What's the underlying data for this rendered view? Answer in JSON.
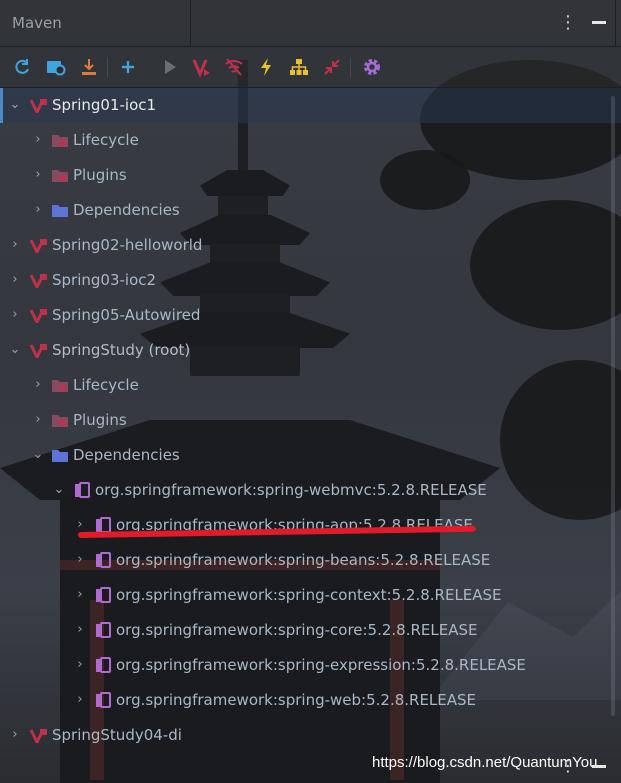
{
  "window": {
    "title": "Maven",
    "kebab_glyph": "⋮"
  },
  "toolbar": {
    "buttons": [
      {
        "name": "reload-icon",
        "color": "#3da5e0"
      },
      {
        "name": "generate-sources-icon",
        "color": "#3da5e0"
      },
      {
        "name": "download-icon",
        "color": "#e07b3d"
      },
      {
        "name": "add-icon",
        "color": "#3da5e0"
      },
      {
        "name": "run-icon",
        "color": "#6b6f75"
      },
      {
        "name": "execute-goal-icon",
        "color": "#c0304a"
      },
      {
        "name": "toggle-offline-icon",
        "color": "#c0304a"
      },
      {
        "name": "skip-tests-icon",
        "color": "#e8c12e"
      },
      {
        "name": "show-dependencies-icon",
        "color": "#e8c12e"
      },
      {
        "name": "collapse-all-icon",
        "color": "#c0304a"
      },
      {
        "name": "settings-icon",
        "color": "#a66bd4"
      }
    ]
  },
  "tree": {
    "rows": [
      {
        "label": "Spring01-ioc1",
        "expanded": true,
        "icon": "maven-project-icon",
        "level": 0
      },
      {
        "label": "Lifecycle",
        "expanded": false,
        "icon": "folder-gear-icon",
        "level": 1
      },
      {
        "label": "Plugins",
        "expanded": false,
        "icon": "folder-gear-icon",
        "level": 1
      },
      {
        "label": "Dependencies",
        "expanded": false,
        "icon": "folder-blue-icon",
        "level": 1
      },
      {
        "label": "Spring02-helloworld",
        "expanded": false,
        "icon": "maven-project-icon",
        "level": 0
      },
      {
        "label": "Spring03-ioc2",
        "expanded": false,
        "icon": "maven-project-icon",
        "level": 0
      },
      {
        "label": "Spring05-Autowired",
        "expanded": false,
        "icon": "maven-project-icon",
        "level": 0
      },
      {
        "label": "SpringStudy (root)",
        "expanded": true,
        "icon": "maven-project-icon",
        "level": 0
      },
      {
        "label": "Lifecycle",
        "expanded": false,
        "icon": "folder-gear-icon",
        "level": 1
      },
      {
        "label": "Plugins",
        "expanded": false,
        "icon": "folder-gear-icon",
        "level": 1
      },
      {
        "label": "Dependencies",
        "expanded": true,
        "icon": "folder-blue-icon",
        "level": 1
      },
      {
        "label": "org.springframework:spring-webmvc:5.2.8.RELEASE",
        "expanded": true,
        "icon": "library-icon",
        "level": 2
      },
      {
        "label": "org.springframework:spring-aop:5.2.8.RELEASE",
        "expanded": false,
        "icon": "library-icon",
        "level": 3
      },
      {
        "label": "org.springframework:spring-beans:5.2.8.RELEASE",
        "expanded": false,
        "icon": "library-icon",
        "level": 3
      },
      {
        "label": "org.springframework:spring-context:5.2.8.RELEASE",
        "expanded": false,
        "icon": "library-icon",
        "level": 3
      },
      {
        "label": "org.springframework:spring-core:5.2.8.RELEASE",
        "expanded": false,
        "icon": "library-icon",
        "level": 3
      },
      {
        "label": "org.springframework:spring-expression:5.2.8.RELEASE",
        "expanded": false,
        "icon": "library-icon",
        "level": 3
      },
      {
        "label": "org.springframework:spring-web:5.2.8.RELEASE",
        "expanded": false,
        "icon": "library-icon",
        "level": 3
      },
      {
        "label": "SpringStudy04-di",
        "expanded": false,
        "icon": "maven-project-icon",
        "level": 0
      }
    ]
  },
  "watermark": "https://blog.csdn.net/QuantumYou",
  "colors": {
    "maven_red": "#c0304a",
    "library_purple": "#b06ad0",
    "folder_blue": "#5b74d6",
    "highlight_underline": "#e21b2a",
    "selection": "#283850"
  }
}
